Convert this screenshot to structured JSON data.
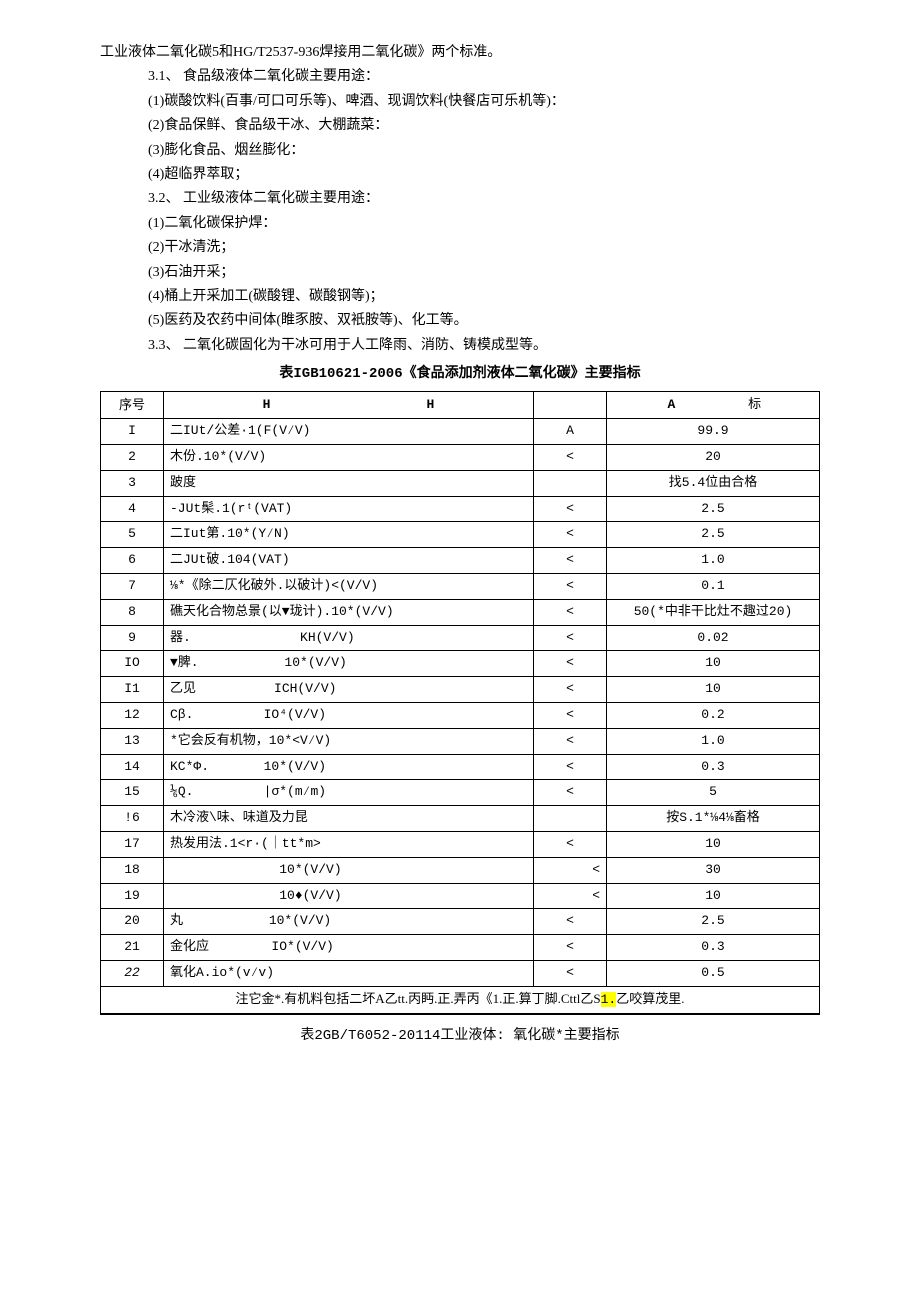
{
  "intro": "工业液体二氧化碳5和HG/T2537-936焊接用二氧化碳》两个标准。",
  "s31": "3.1、 食品级液体二氧化碳主要用途：",
  "s31_1": "(1)碳酸饮料(百事/可口可乐等)、啤酒、现调饮料(快餐店可乐机等)：",
  "s31_2": "(2)食品保鲜、食品级干冰、大棚蔬菜：",
  "s31_3": "(3)膨化食品、烟丝膨化：",
  "s31_4": "(4)超临界萃取；",
  "s32": "3.2、 工业级液体二氧化碳主要用途：",
  "s32_1": "(1)二氧化碳保护焊：",
  "s32_2": "(2)干冰清洗；",
  "s32_3": "(3)石油开采；",
  "s32_4": "(4)桶上开采加工(碳酸锂、碳酸钢等)；",
  "s32_5": "(5)医药及农药中间体(睢豕胺、双衹胺等)、化工等。",
  "s33": "3.3、 二氧化碳固化为干冰可用于人工降雨、消防、铸模成型等。",
  "table1_title": "表IGB10621-2006《食品添加剂液体二氧化碳》主要指标",
  "table1": {
    "h_num": "序号",
    "h_item1": "H",
    "h_item2": "H",
    "h_sym": "",
    "h_val1": "A",
    "h_val2": "标",
    "rows": [
      {
        "n": "I",
        "item": "二IUt/公差·1(F(V⁄V)",
        "sym": "A",
        "val": "99.9"
      },
      {
        "n": "2",
        "item": "木份.10*(V/V)",
        "sym": "<",
        "val": "20"
      },
      {
        "n": "3",
        "item": "跛度",
        "sym": "",
        "val": "找5.4位由合格"
      },
      {
        "n": "4",
        "item": "-JUt髤.1(rᵗ(VAT)",
        "sym": "<",
        "val": "2.5"
      },
      {
        "n": "5",
        "item": "二Iut第.10*(Y⁄N)",
        "sym": "<",
        "val": "2.5"
      },
      {
        "n": "6",
        "item": "二JUt破.104(VAT)",
        "sym": "<",
        "val": "1.0"
      },
      {
        "n": "7",
        "item": "⅛*《除二仄化破外.以破计)<(V/V)",
        "sym": "<",
        "val": "0.1"
      },
      {
        "n": "8",
        "item": "礁天化合物总景(以▼珑计).10*(V/V)",
        "sym": "<",
        "val": "50(*中非干比灶不趣过20)"
      },
      {
        "n": "9",
        "item": "器.              KH(V/V)",
        "sym": "<",
        "val": "0.02"
      },
      {
        "n": "IO",
        "item": "▼脾.           10*(V/V)",
        "sym": "<",
        "val": "10"
      },
      {
        "n": "I1",
        "item": "乙见          ICH(V/V)",
        "sym": "<",
        "val": "10"
      },
      {
        "n": "12",
        "item": "Cβ.         IO⁴(V/V)",
        "sym": "<",
        "val": "0.2"
      },
      {
        "n": "13",
        "item": "*它会反有机物，10*<V⁄V)",
        "sym": "<",
        "val": "1.0"
      },
      {
        "n": "14",
        "item": "KC*Φ.       10*(V/V)",
        "sym": "<",
        "val": "0.3"
      },
      {
        "n": "15",
        "item": "⅙Q.         |σ*(m⁄m)",
        "sym": "<",
        "val": "5"
      },
      {
        "n": "!6",
        "item": "木冷液\\味、味道及力昆",
        "sym": "",
        "val": "按S.1*⅛4⅛畜格"
      },
      {
        "n": "17",
        "item": "热发用法.1<r·(｜tt*m>",
        "sym": "<",
        "val": "10"
      },
      {
        "n": "18",
        "item": "              10*(V/V)",
        "sym": "<",
        "val": "30"
      },
      {
        "n": "19",
        "item": "              10♦(V/V)",
        "sym": "<",
        "val": "10"
      },
      {
        "n": "20",
        "item": "丸           10*(V/V)",
        "sym": "<",
        "val": "2.5"
      },
      {
        "n": "21",
        "item": "金化应        IO*(V/V)",
        "sym": "<",
        "val": "0.3"
      },
      {
        "n": "22",
        "item": "氧化A.io*(v⁄v)",
        "sym": "<",
        "val": "0.5"
      }
    ],
    "footnote_pre": "注它金*.有机料包括二坏A乙tt.丙眄.正.弄丙《1.正.算丁脚.Cttl乙S",
    "footnote_hl": "1.",
    "footnote_post": "乙咬算茂里."
  },
  "table2_title": "表2GB/T6052-20114工业液体: 氧化碳*主要指标"
}
